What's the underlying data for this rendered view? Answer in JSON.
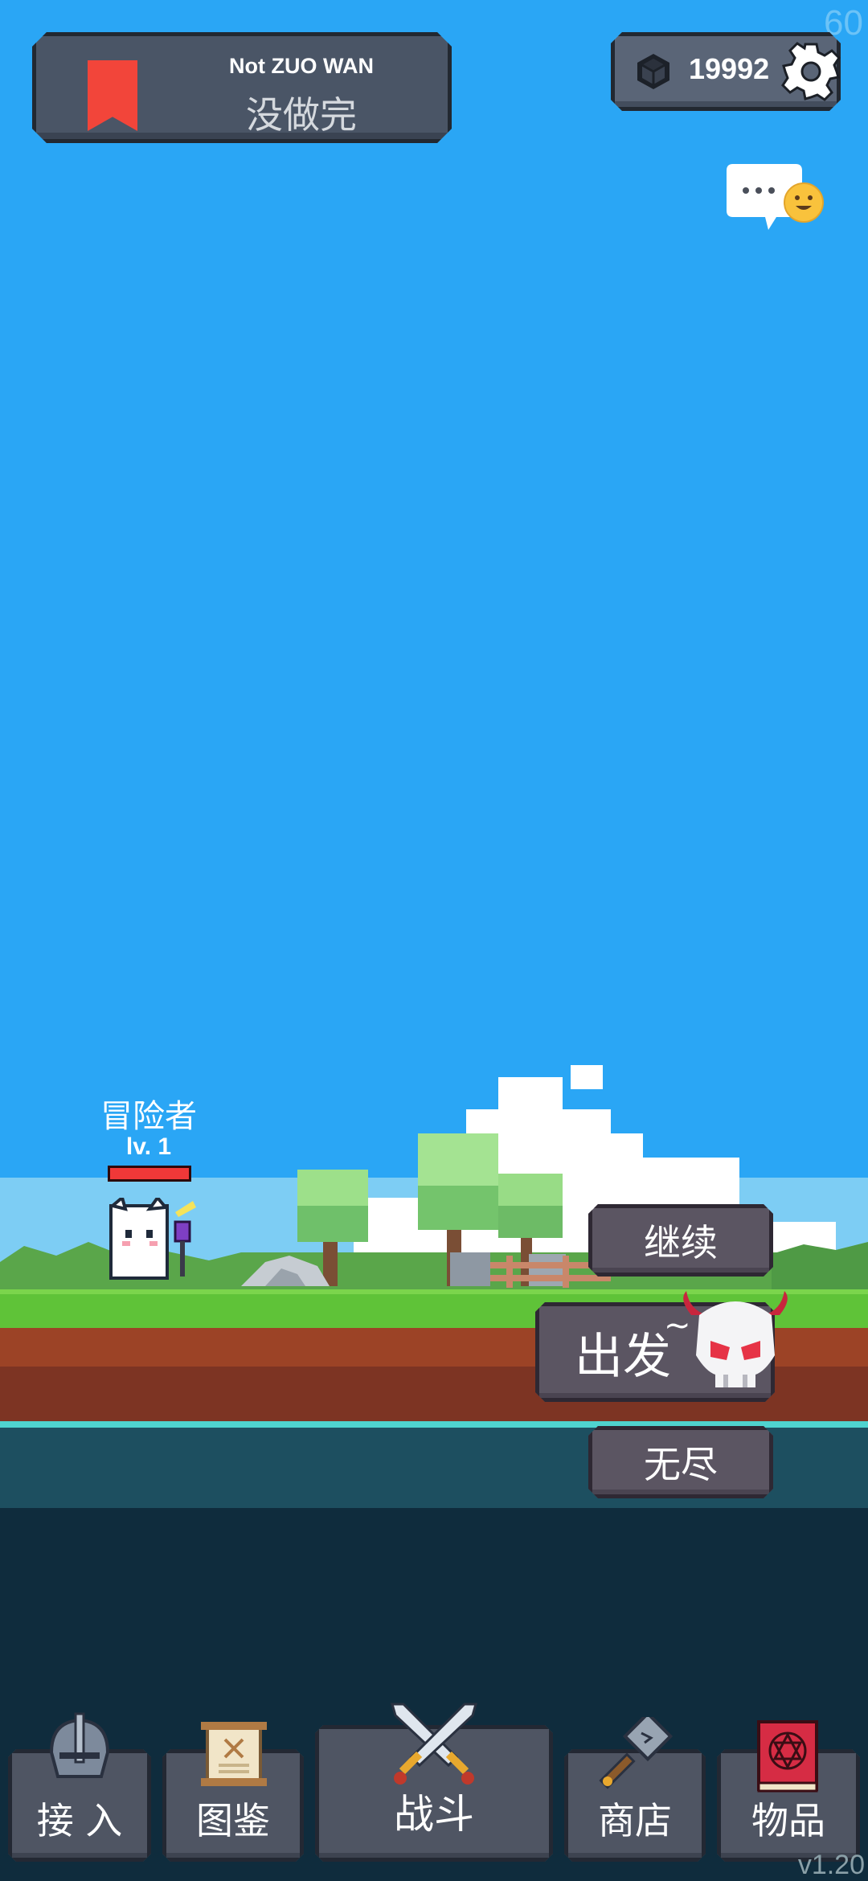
{
  "status": {
    "fps": "60",
    "version": "v1.20"
  },
  "banner": {
    "subtitle": "Not ZUO WAN",
    "title": "没做完"
  },
  "currency": {
    "value": "19992"
  },
  "hero": {
    "name": "冒险者",
    "level": "lv. 1",
    "hp_fraction": 1.0
  },
  "actions": {
    "continue": "继续",
    "depart": "出发",
    "depart_suffix": "~",
    "endless": "无尽"
  },
  "nav": {
    "items": [
      {
        "label": "接 入",
        "icon": "helmet-icon"
      },
      {
        "label": "图鉴",
        "icon": "scroll-icon"
      },
      {
        "label": "战斗",
        "icon": "crossed-swords-icon"
      },
      {
        "label": "商店",
        "icon": "hammer-icon"
      },
      {
        "label": "物品",
        "icon": "spellbook-icon"
      }
    ]
  },
  "colors": {
    "sky": "#2aa6f5",
    "accent_red": "#f2453a",
    "button": "#5b5562",
    "panel": "#4a5566"
  }
}
